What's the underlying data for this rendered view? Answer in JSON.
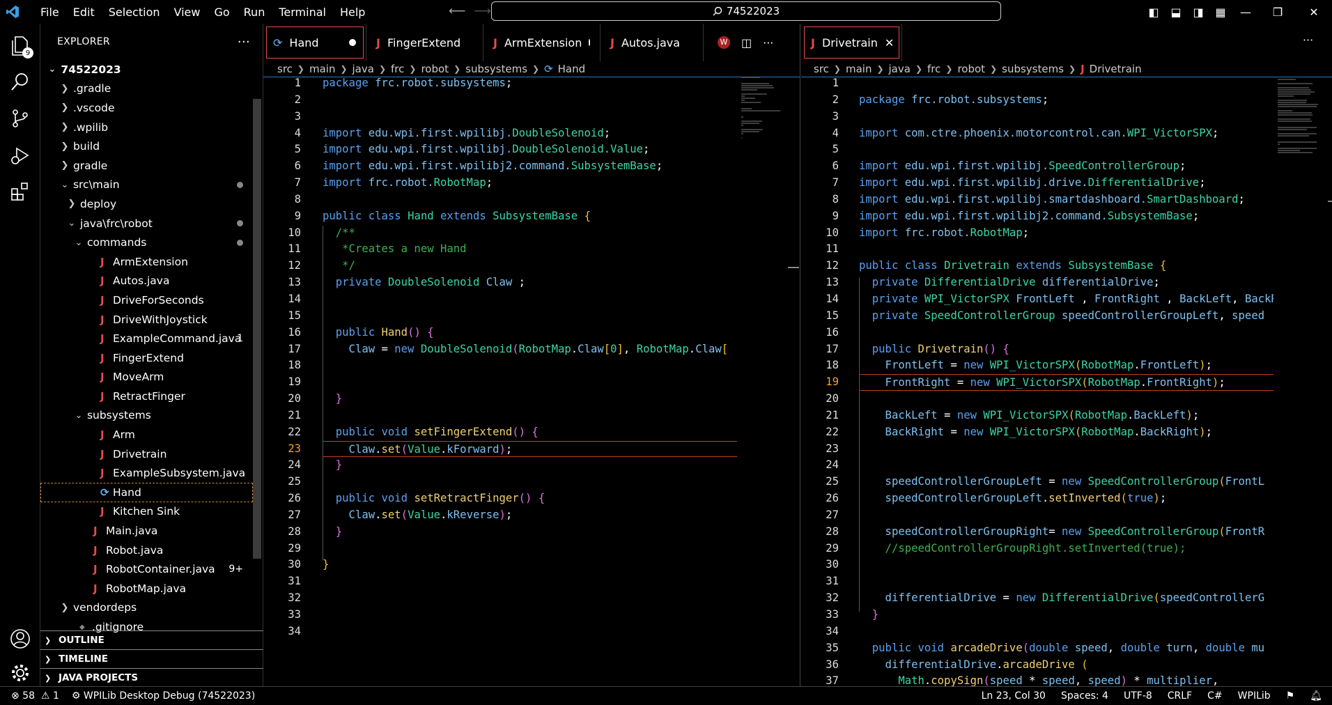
{
  "menu": [
    "File",
    "Edit",
    "Selection",
    "View",
    "Go",
    "Run",
    "Terminal",
    "Help"
  ],
  "search": {
    "text": "74522023"
  },
  "activity": {
    "explorer_badge": "9"
  },
  "explorer": {
    "title": "EXPLORER",
    "root": "74522023",
    "items": [
      {
        "label": ".gradle",
        "type": "folder",
        "depth": 1,
        "open": false
      },
      {
        "label": ".vscode",
        "type": "folder",
        "depth": 1,
        "open": false
      },
      {
        "label": ".wpilib",
        "type": "folder",
        "depth": 1,
        "open": false
      },
      {
        "label": "build",
        "type": "folder",
        "depth": 1,
        "open": false
      },
      {
        "label": "gradle",
        "type": "folder",
        "depth": 1,
        "open": false
      },
      {
        "label": "src\\main",
        "type": "folder",
        "depth": 1,
        "open": true,
        "dot": true
      },
      {
        "label": "deploy",
        "type": "folder",
        "depth": 2,
        "open": false
      },
      {
        "label": "java\\frc\\robot",
        "type": "folder",
        "depth": 2,
        "open": true,
        "dot": true
      },
      {
        "label": "commands",
        "type": "folder",
        "depth": 3,
        "open": true,
        "dot": true
      },
      {
        "label": "ArmExtension",
        "type": "java",
        "depth": 4
      },
      {
        "label": "Autos.java",
        "type": "java",
        "depth": 4
      },
      {
        "label": "DriveForSeconds",
        "type": "java",
        "depth": 4
      },
      {
        "label": "DriveWithJoystick",
        "type": "java",
        "depth": 4
      },
      {
        "label": "ExampleCommand.java",
        "type": "java",
        "depth": 4,
        "count": "1"
      },
      {
        "label": "FingerExtend",
        "type": "java",
        "depth": 4
      },
      {
        "label": "MoveArm",
        "type": "java",
        "depth": 4
      },
      {
        "label": "RetractFinger",
        "type": "java",
        "depth": 4
      },
      {
        "label": "subsystems",
        "type": "folder",
        "depth": 3,
        "open": true
      },
      {
        "label": "Arm",
        "type": "java",
        "depth": 4
      },
      {
        "label": "Drivetrain",
        "type": "java",
        "depth": 4
      },
      {
        "label": "ExampleSubsystem.java",
        "type": "java",
        "depth": 4
      },
      {
        "label": "Hand",
        "type": "sync",
        "depth": 4,
        "selected": true
      },
      {
        "label": "Kitchen Sink",
        "type": "java",
        "depth": 4
      },
      {
        "label": "Main.java",
        "type": "java",
        "depth": 3
      },
      {
        "label": "Robot.java",
        "type": "java",
        "depth": 3
      },
      {
        "label": "RobotContainer.java",
        "type": "java",
        "depth": 3,
        "count": "9+"
      },
      {
        "label": "RobotMap.java",
        "type": "java",
        "depth": 3
      },
      {
        "label": "vendordeps",
        "type": "folder",
        "depth": 1,
        "open": false
      },
      {
        "label": ".gitignore",
        "type": "git",
        "depth": 1
      }
    ],
    "sections": [
      "OUTLINE",
      "TIMELINE",
      "JAVA PROJECTS"
    ]
  },
  "left_tabs": [
    {
      "label": "Hand",
      "icon": "sync",
      "modified": true,
      "active": true
    },
    {
      "label": "FingerExtend",
      "icon": "java"
    },
    {
      "label": "ArmExtension",
      "icon": "java",
      "modified": true
    },
    {
      "label": "Autos.java",
      "icon": "java"
    }
  ],
  "right_tabs": [
    {
      "label": "Drivetrain",
      "icon": "java",
      "active": true,
      "close": "✕"
    }
  ],
  "left_breadcrumb": [
    "src",
    "main",
    "java",
    "frc",
    "robot",
    "subsystems",
    "Hand"
  ],
  "right_breadcrumb": [
    "src",
    "main",
    "java",
    "frc",
    "robot",
    "subsystems",
    "Drivetrain"
  ],
  "left_current_line": 23,
  "right_current_line": 19,
  "left_code": [
    [
      [
        "kw",
        "package "
      ],
      [
        "pk",
        "frc.robot.subsystems"
      ],
      [
        "",
        "; "
      ]
    ],
    [],
    [],
    [
      [
        "kw",
        "import "
      ],
      [
        "pk",
        "edu.wpi.first.wpilibj."
      ],
      [
        "ty",
        "DoubleSolenoid"
      ],
      [
        "",
        ";"
      ]
    ],
    [
      [
        "kw",
        "import "
      ],
      [
        "pk",
        "edu.wpi.first.wpilibj."
      ],
      [
        "ty",
        "DoubleSolenoid"
      ],
      [
        "pk",
        "."
      ],
      [
        "ty",
        "Value"
      ],
      [
        "",
        ";"
      ]
    ],
    [
      [
        "kw",
        "import "
      ],
      [
        "pk",
        "edu.wpi.first.wpilibj2.command."
      ],
      [
        "ty",
        "SubsystemBase"
      ],
      [
        "",
        ";"
      ]
    ],
    [
      [
        "kw",
        "import "
      ],
      [
        "pk",
        "frc.robot."
      ],
      [
        "ty",
        "RobotMap"
      ],
      [
        "",
        ";"
      ]
    ],
    [],
    [
      [
        "kw",
        "public class "
      ],
      [
        "ty",
        "Hand "
      ],
      [
        "kw",
        "extends "
      ],
      [
        "ty",
        "SubsystemBase "
      ],
      [
        "br",
        "{"
      ]
    ],
    [
      [
        "cm",
        "  /**"
      ]
    ],
    [
      [
        "cm",
        "   *Creates a new Hand"
      ]
    ],
    [
      [
        "cm",
        "   */"
      ]
    ],
    [
      [
        "kw",
        "  private "
      ],
      [
        "ty",
        "DoubleSolenoid "
      ],
      [
        "pk",
        "Claw "
      ],
      [
        "",
        ";"
      ]
    ],
    [],
    [],
    [
      [
        "kw",
        "  public "
      ],
      [
        "fn",
        "Hand"
      ],
      [
        "br2",
        "() {"
      ]
    ],
    [
      [
        "pk",
        "    Claw "
      ],
      [
        "",
        "= "
      ],
      [
        "kw",
        "new "
      ],
      [
        "ty",
        "DoubleSolenoid"
      ],
      [
        "br2",
        "("
      ],
      [
        "ty",
        "RobotMap"
      ],
      [
        "",
        "."
      ],
      [
        "pk",
        "Claw"
      ],
      [
        "br",
        "["
      ],
      [
        "nm",
        "0"
      ],
      [
        "br",
        "]"
      ],
      [
        ",",
        ", "
      ],
      [
        "ty",
        "RobotMap"
      ],
      [
        "",
        "."
      ],
      [
        "pk",
        "Claw"
      ],
      [
        "br",
        "["
      ]
    ],
    [],
    [],
    [
      [
        "br2",
        "  }"
      ]
    ],
    [],
    [
      [
        "kw",
        "  public void "
      ],
      [
        "fn",
        "setFingerExtend"
      ],
      [
        "br2",
        "() {"
      ]
    ],
    [
      [
        "pk",
        "    Claw"
      ],
      [
        "",
        "."
      ],
      [
        "fn",
        "set"
      ],
      [
        "br2",
        "("
      ],
      [
        "ty",
        "Value"
      ],
      [
        "",
        "."
      ],
      [
        "pk",
        "kForward"
      ],
      [
        "br2",
        ")"
      ],
      [
        "",
        ";"
      ]
    ],
    [
      [
        "br2",
        "  }"
      ]
    ],
    [],
    [
      [
        "kw",
        "  public void "
      ],
      [
        "fn",
        "setRetractFinger"
      ],
      [
        "br2",
        "() {"
      ]
    ],
    [
      [
        "pk",
        "    Claw"
      ],
      [
        "",
        "."
      ],
      [
        "fn",
        "set"
      ],
      [
        "br2",
        "("
      ],
      [
        "ty",
        "Value"
      ],
      [
        "",
        "."
      ],
      [
        "pk",
        "kReverse"
      ],
      [
        "br2",
        ")"
      ],
      [
        "",
        ";"
      ]
    ],
    [
      [
        "br2",
        "  }"
      ]
    ],
    [],
    [
      [
        "br",
        "}"
      ]
    ],
    [],
    [],
    [],
    []
  ],
  "right_code": [
    [],
    [
      [
        "kw",
        "package "
      ],
      [
        "pk",
        "frc.robot.subsystems"
      ],
      [
        "",
        ";"
      ]
    ],
    [],
    [
      [
        "kw",
        "import "
      ],
      [
        "pk",
        "com.ctre.phoenix.motorcontrol.can."
      ],
      [
        "ty",
        "WPI_VictorSPX"
      ],
      [
        "",
        ";"
      ]
    ],
    [],
    [
      [
        "kw",
        "import "
      ],
      [
        "pk",
        "edu.wpi.first.wpilibj."
      ],
      [
        "ty",
        "SpeedControllerGroup"
      ],
      [
        "",
        ";"
      ]
    ],
    [
      [
        "kw",
        "import "
      ],
      [
        "pk",
        "edu.wpi.first.wpilibj.drive."
      ],
      [
        "ty",
        "DifferentialDrive"
      ],
      [
        "",
        ";"
      ]
    ],
    [
      [
        "kw",
        "import "
      ],
      [
        "pk",
        "edu.wpi.first.wpilibj.smartdashboard."
      ],
      [
        "ty",
        "SmartDashboard"
      ],
      [
        "",
        ";"
      ]
    ],
    [
      [
        "kw",
        "import "
      ],
      [
        "pk",
        "edu.wpi.first.wpilibj2.command."
      ],
      [
        "ty",
        "SubsystemBase"
      ],
      [
        "",
        ";"
      ]
    ],
    [
      [
        "kw",
        "import "
      ],
      [
        "pk",
        "frc.robot."
      ],
      [
        "ty",
        "RobotMap"
      ],
      [
        "",
        ";"
      ]
    ],
    [],
    [
      [
        "kw",
        "public class "
      ],
      [
        "ty",
        "Drivetrain "
      ],
      [
        "kw",
        "extends "
      ],
      [
        "ty",
        "SubsystemBase "
      ],
      [
        "br",
        "{"
      ]
    ],
    [
      [
        "kw",
        "  private "
      ],
      [
        "ty",
        "DifferentialDrive "
      ],
      [
        "pk",
        "differentialDrive"
      ],
      [
        "",
        ";"
      ]
    ],
    [
      [
        "kw",
        "  private "
      ],
      [
        "ty",
        "WPI_VictorSPX "
      ],
      [
        "pk",
        "FrontLeft"
      ],
      [
        "",
        " , "
      ],
      [
        "pk",
        "FrontRight"
      ],
      [
        "",
        " , "
      ],
      [
        "pk",
        "BackLeft"
      ],
      [
        "",
        ", "
      ],
      [
        "pk",
        "BackR"
      ]
    ],
    [
      [
        "kw",
        "  private "
      ],
      [
        "ty",
        "SpeedControllerGroup "
      ],
      [
        "pk",
        "speedControllerGroupLeft"
      ],
      [
        "",
        ", "
      ],
      [
        "pk",
        "speed"
      ]
    ],
    [],
    [
      [
        "kw",
        "  public "
      ],
      [
        "fn",
        "Drivetrain"
      ],
      [
        "br2",
        "() {"
      ]
    ],
    [
      [
        "pk",
        "    FrontLeft "
      ],
      [
        "",
        "= "
      ],
      [
        "kw",
        "new "
      ],
      [
        "ty",
        "WPI_VictorSPX"
      ],
      [
        "br",
        "("
      ],
      [
        "ty",
        "RobotMap"
      ],
      [
        "",
        "."
      ],
      [
        "pk",
        "FrontLeft"
      ],
      [
        "br",
        ")"
      ],
      [
        "",
        ";"
      ]
    ],
    [
      [
        "pk",
        "    FrontRight "
      ],
      [
        "",
        "= "
      ],
      [
        "kw",
        "new "
      ],
      [
        "ty",
        "WPI_VictorSPX"
      ],
      [
        "br",
        "("
      ],
      [
        "ty",
        "RobotMap"
      ],
      [
        "",
        "."
      ],
      [
        "pk",
        "FrontRight"
      ],
      [
        "br",
        ")"
      ],
      [
        "",
        ";"
      ]
    ],
    [],
    [
      [
        "pk",
        "    BackLeft "
      ],
      [
        "",
        "= "
      ],
      [
        "kw",
        "new "
      ],
      [
        "ty",
        "WPI_VictorSPX"
      ],
      [
        "br",
        "("
      ],
      [
        "ty",
        "RobotMap"
      ],
      [
        "",
        "."
      ],
      [
        "pk",
        "BackLeft"
      ],
      [
        "br",
        ")"
      ],
      [
        "",
        ";"
      ]
    ],
    [
      [
        "pk",
        "    BackRight "
      ],
      [
        "",
        "= "
      ],
      [
        "kw",
        "new "
      ],
      [
        "ty",
        "WPI_VictorSPX"
      ],
      [
        "br",
        "("
      ],
      [
        "ty",
        "RobotMap"
      ],
      [
        "",
        "."
      ],
      [
        "pk",
        "BackRight"
      ],
      [
        "br",
        ")"
      ],
      [
        "",
        ";"
      ]
    ],
    [],
    [],
    [
      [
        "pk",
        "    speedControllerGroupLeft "
      ],
      [
        "",
        "= "
      ],
      [
        "kw",
        "new "
      ],
      [
        "ty",
        "SpeedControllerGroup"
      ],
      [
        "br",
        "("
      ],
      [
        "pk",
        "FrontL"
      ]
    ],
    [
      [
        "pk",
        "    speedControllerGroupLeft"
      ],
      [
        "",
        "."
      ],
      [
        "fn",
        "setInverted"
      ],
      [
        "br",
        "("
      ],
      [
        "kw",
        "true"
      ],
      [
        "br",
        ")"
      ],
      [
        "",
        ";"
      ]
    ],
    [],
    [
      [
        "pk",
        "    speedControllerGroupRight"
      ],
      [
        "",
        "= "
      ],
      [
        "kw",
        "new "
      ],
      [
        "ty",
        "SpeedControllerGroup"
      ],
      [
        "br",
        "("
      ],
      [
        "pk",
        "FrontR"
      ]
    ],
    [
      [
        "cm",
        "    //speedControllerGroupRight.setInverted(true);"
      ]
    ],
    [],
    [],
    [
      [
        "pk",
        "    differentialDrive "
      ],
      [
        "",
        "= "
      ],
      [
        "kw",
        "new "
      ],
      [
        "ty",
        "DifferentialDrive"
      ],
      [
        "br",
        "("
      ],
      [
        "pk",
        "speedControllerG"
      ]
    ],
    [
      [
        "br2",
        "  }"
      ]
    ],
    [],
    [
      [
        "kw",
        "  public void "
      ],
      [
        "fn",
        "arcadeDrive"
      ],
      [
        "br2",
        "("
      ],
      [
        "kw",
        "double "
      ],
      [
        "pk",
        "speed"
      ],
      [
        "",
        ", "
      ],
      [
        "kw",
        "double "
      ],
      [
        "pk",
        "turn"
      ],
      [
        "",
        ", "
      ],
      [
        "kw",
        "double "
      ],
      [
        "pk",
        "mu"
      ]
    ],
    [
      [
        "pk",
        "    differentialDrive"
      ],
      [
        "",
        "."
      ],
      [
        "fn",
        "arcadeDrive "
      ],
      [
        "br",
        "("
      ]
    ],
    [
      [
        "ty",
        "      Math"
      ],
      [
        "",
        "."
      ],
      [
        "fn",
        "copySign"
      ],
      [
        "br2",
        "("
      ],
      [
        "pk",
        "speed "
      ],
      [
        "",
        "* "
      ],
      [
        "pk",
        "speed"
      ],
      [
        "",
        ", "
      ],
      [
        "pk",
        "speed"
      ],
      [
        "br2",
        ")"
      ],
      [
        "",
        " * "
      ],
      [
        "pk",
        "multiplier"
      ],
      [
        "",
        ","
      ]
    ]
  ],
  "status": {
    "errors": "58",
    "warnings": "1",
    "debug": "WPILib Desktop Debug (74522023)",
    "position": "Ln 23, Col 30",
    "spaces": "Spaces: 4",
    "encoding": "UTF-8",
    "eol": "CRLF",
    "lang": "C#",
    "wpilib": "WPILib"
  }
}
